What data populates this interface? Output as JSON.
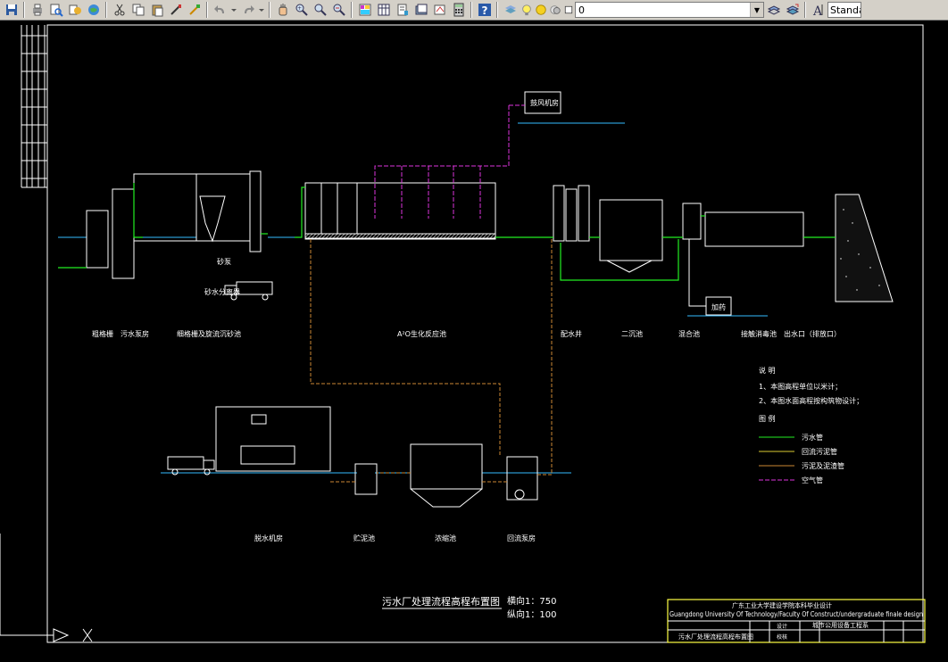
{
  "toolbar": {
    "layer_value": "0",
    "style_value": "Standa"
  },
  "drawing": {
    "title_main": "污水厂处理流程高程布置图",
    "scale_h": "横向1：750",
    "scale_v": "纵向1：100",
    "process_labels": {
      "coarse_screen": "粗格栅",
      "lift_pump": "污水泵房",
      "grit_tank": "细格栅及旋流沉砂池",
      "bio_tank": "A²O生化反应池",
      "distribution": "配水井",
      "secondary": "二沉池",
      "mixing": "混合池",
      "contact": "接触消毒池",
      "outfall": "出水口（排放口）",
      "blower": "鼓风机房",
      "dosing": "加药",
      "sand_separator": "砂水分离器",
      "sand_pump": "砂泵",
      "dewatering_room": "脱水机房",
      "sludge_storage": "贮泥池",
      "thickener": "浓缩池",
      "sludge_pump": "回流泵房"
    },
    "notes": {
      "heading": "说 明",
      "item1": "1、本图高程单位以米计；",
      "item2": "2、本图水面高程按构筑物设计；",
      "legend_heading": "图 例",
      "legend_sewage": "污水管",
      "legend_return": "回流污泥管",
      "legend_sludge": "污泥及泥渣管",
      "legend_air": "空气管"
    },
    "colors": {
      "sewage": "#22ee22",
      "return_sludge": "#ddcc33",
      "sludge": "#cc8833",
      "air": "#dd33dd",
      "structure": "#ffffff",
      "water": "#33bbff"
    },
    "title_block": {
      "school": "广东工业大学建设学院本科毕业设计",
      "english": "Guangdong University Of Technology/Faculty Of Construct/undergraduate finale design",
      "project": "城市公用设备工程系",
      "drawing_name": "污水厂处理流程高程布置图",
      "role1": "设计",
      "role2": "校核"
    }
  }
}
